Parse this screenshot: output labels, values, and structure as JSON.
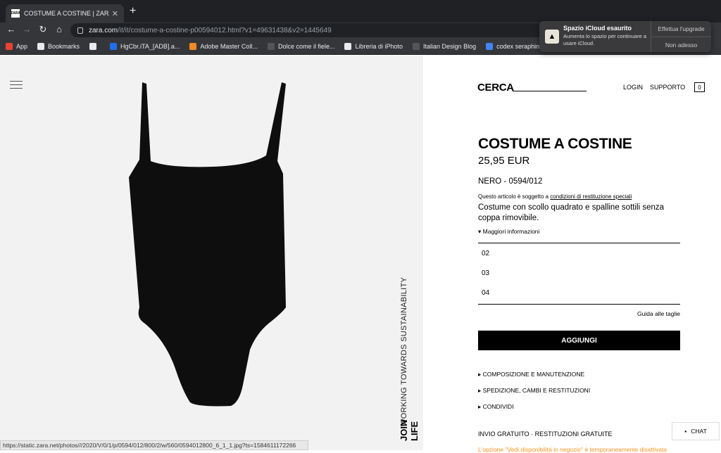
{
  "browser": {
    "tab_title": "COSTUME A COSTINE | ZARA It",
    "tab_favicon": "ZARA",
    "url_domain": "zara.com",
    "url_path": "/it/it/costume-a-costine-p00594012.html?v1=49631438&v2=1445649",
    "bookmarks": [
      {
        "label": "App",
        "icon": "apps-grid-icon",
        "color": "#ea4335"
      },
      {
        "label": "Bookmarks",
        "icon": "star-icon",
        "color": "#e8eaed"
      },
      {
        "label": "",
        "icon": "globe-icon",
        "color": "#e8eaed"
      },
      {
        "label": "HgCbr.iTA_[ADB].a...",
        "icon": "ps-icon",
        "color": "#1f6feb"
      },
      {
        "label": "Adobe Master Coll...",
        "icon": "adobe-icon",
        "color": "#f28b25"
      },
      {
        "label": "Dolce come il fiele...",
        "icon": "blog-icon",
        "color": "#555"
      },
      {
        "label": "Libreria di iPhoto",
        "icon": "globe-icon",
        "color": "#e8eaed"
      },
      {
        "label": "Italian Design Blog",
        "icon": "blog-icon",
        "color": "#555"
      },
      {
        "label": "codex seraphinianu...",
        "icon": "google-icon",
        "color": "#4285f4"
      }
    ]
  },
  "notification": {
    "title": "Spazio iCloud esaurito",
    "body": "Aumenta lo spazio per continuare a usare iCloud.",
    "primary": "Effettua l'upgrade",
    "secondary": "Non adesso"
  },
  "header": {
    "search": "CERCA",
    "login": "LOGIN",
    "support": "SUPPORTO",
    "bag_count": "0"
  },
  "product": {
    "title": "COSTUME A COSTINE",
    "price": "25,95 EUR",
    "color": "NERO - 0594/012",
    "notice_prefix": "Questo articolo è soggetto a ",
    "notice_link": "condizioni di restituzione speciali",
    "description": "Costume con scollo quadrato e spalline sottili senza coppa rimovibile.",
    "more_info": "Maggiori informazioni",
    "sizes": [
      "02",
      "03",
      "04"
    ],
    "size_guide": "Guida alle taglie",
    "add_button": "AGGIUNGI",
    "accordions": [
      "COMPOSIZIONE E MANUTENZIONE",
      "SPEDIZIONE, CAMBI E RESTITUZIONI",
      "CONDIVIDI"
    ],
    "shipping": "INVIO GRATUITO  ·  RESTITUZIONI GRATUITE",
    "orange_notice": "L'opzione \"Vedi disponibilità in negozio\" è temporaneamente disattivata"
  },
  "side": {
    "vertical_text": "WORKING TOWARDS SUSTAINABILITY",
    "vertical_logo": "JOIN LIFE"
  },
  "chat": "CHAT",
  "status_url": "https://static.zara.net/photos///2020/V/0/1/p/0594/012/800/2/w/560/0594012800_6_1_1.jpg?ts=1584611172266"
}
